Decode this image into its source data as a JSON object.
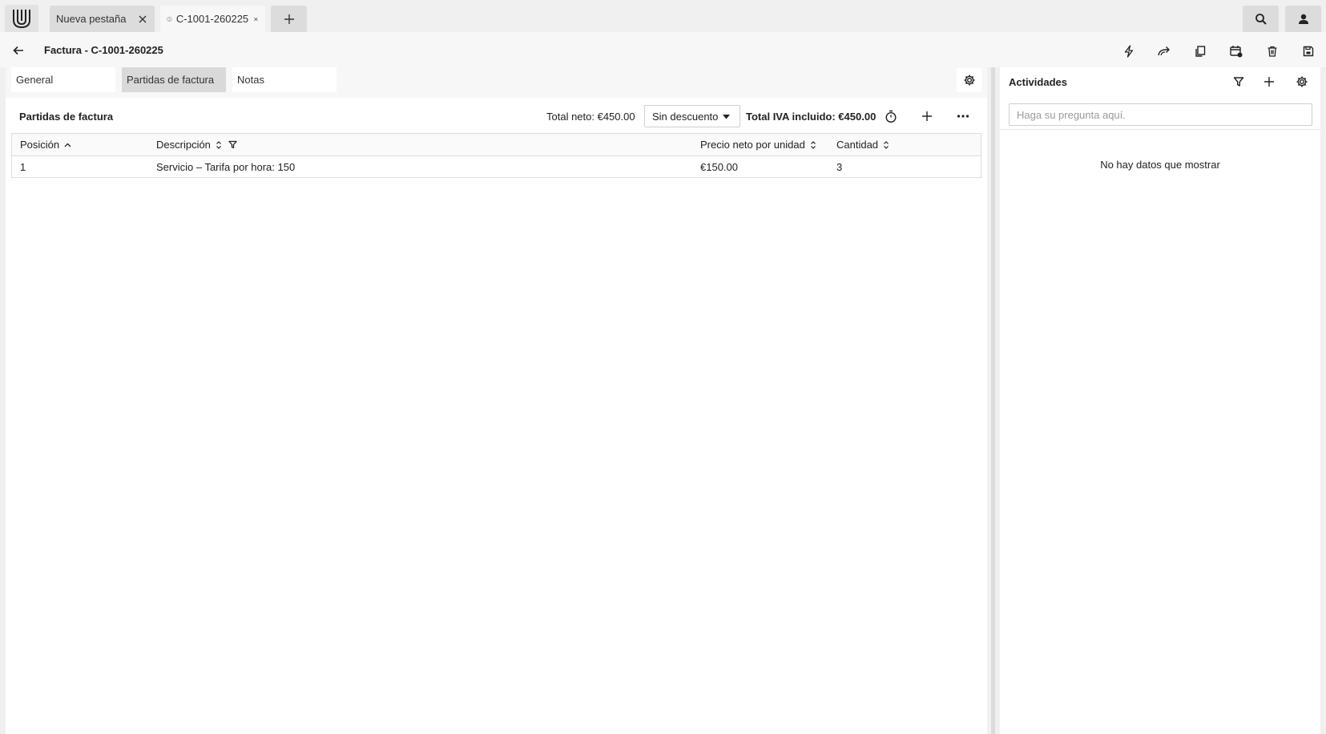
{
  "browser_tabs": [
    {
      "label": "Nueva pestaña",
      "icon": "none"
    },
    {
      "label": "C-1001-260225",
      "icon": "dollar-circle-icon"
    }
  ],
  "header": {
    "title": "Factura - C-1001-260225",
    "actions": [
      "lightning-icon",
      "forward-icon",
      "copy-icon",
      "calendar-settings-icon",
      "trash-icon",
      "save-icon"
    ]
  },
  "panel_tabs": [
    {
      "label": "General"
    },
    {
      "label": "Partidas de factura"
    },
    {
      "label": "Notas"
    }
  ],
  "items_section": {
    "title": "Partidas de factura",
    "total_neto": "Total neto: €450.00",
    "discount": "Sin descuento",
    "total_iva": "Total IVA incluido: €450.00"
  },
  "table": {
    "columns": [
      "Posición",
      "Descripción",
      "Precio neto por unidad",
      "Cantidad"
    ],
    "rows": [
      {
        "posicion": "1",
        "descripcion": "Servicio – Tarifa por hora: 150",
        "precio": "€150.00",
        "cantidad": "3"
      }
    ]
  },
  "activities": {
    "title": "Actividades",
    "search_placeholder": "Haga su pregunta aquí.",
    "empty_text": "No hay datos que mostrar"
  },
  "colors": {
    "background": "#f0f0f0",
    "active_tab": "#d9d9d9",
    "panel": "#ffffff"
  }
}
